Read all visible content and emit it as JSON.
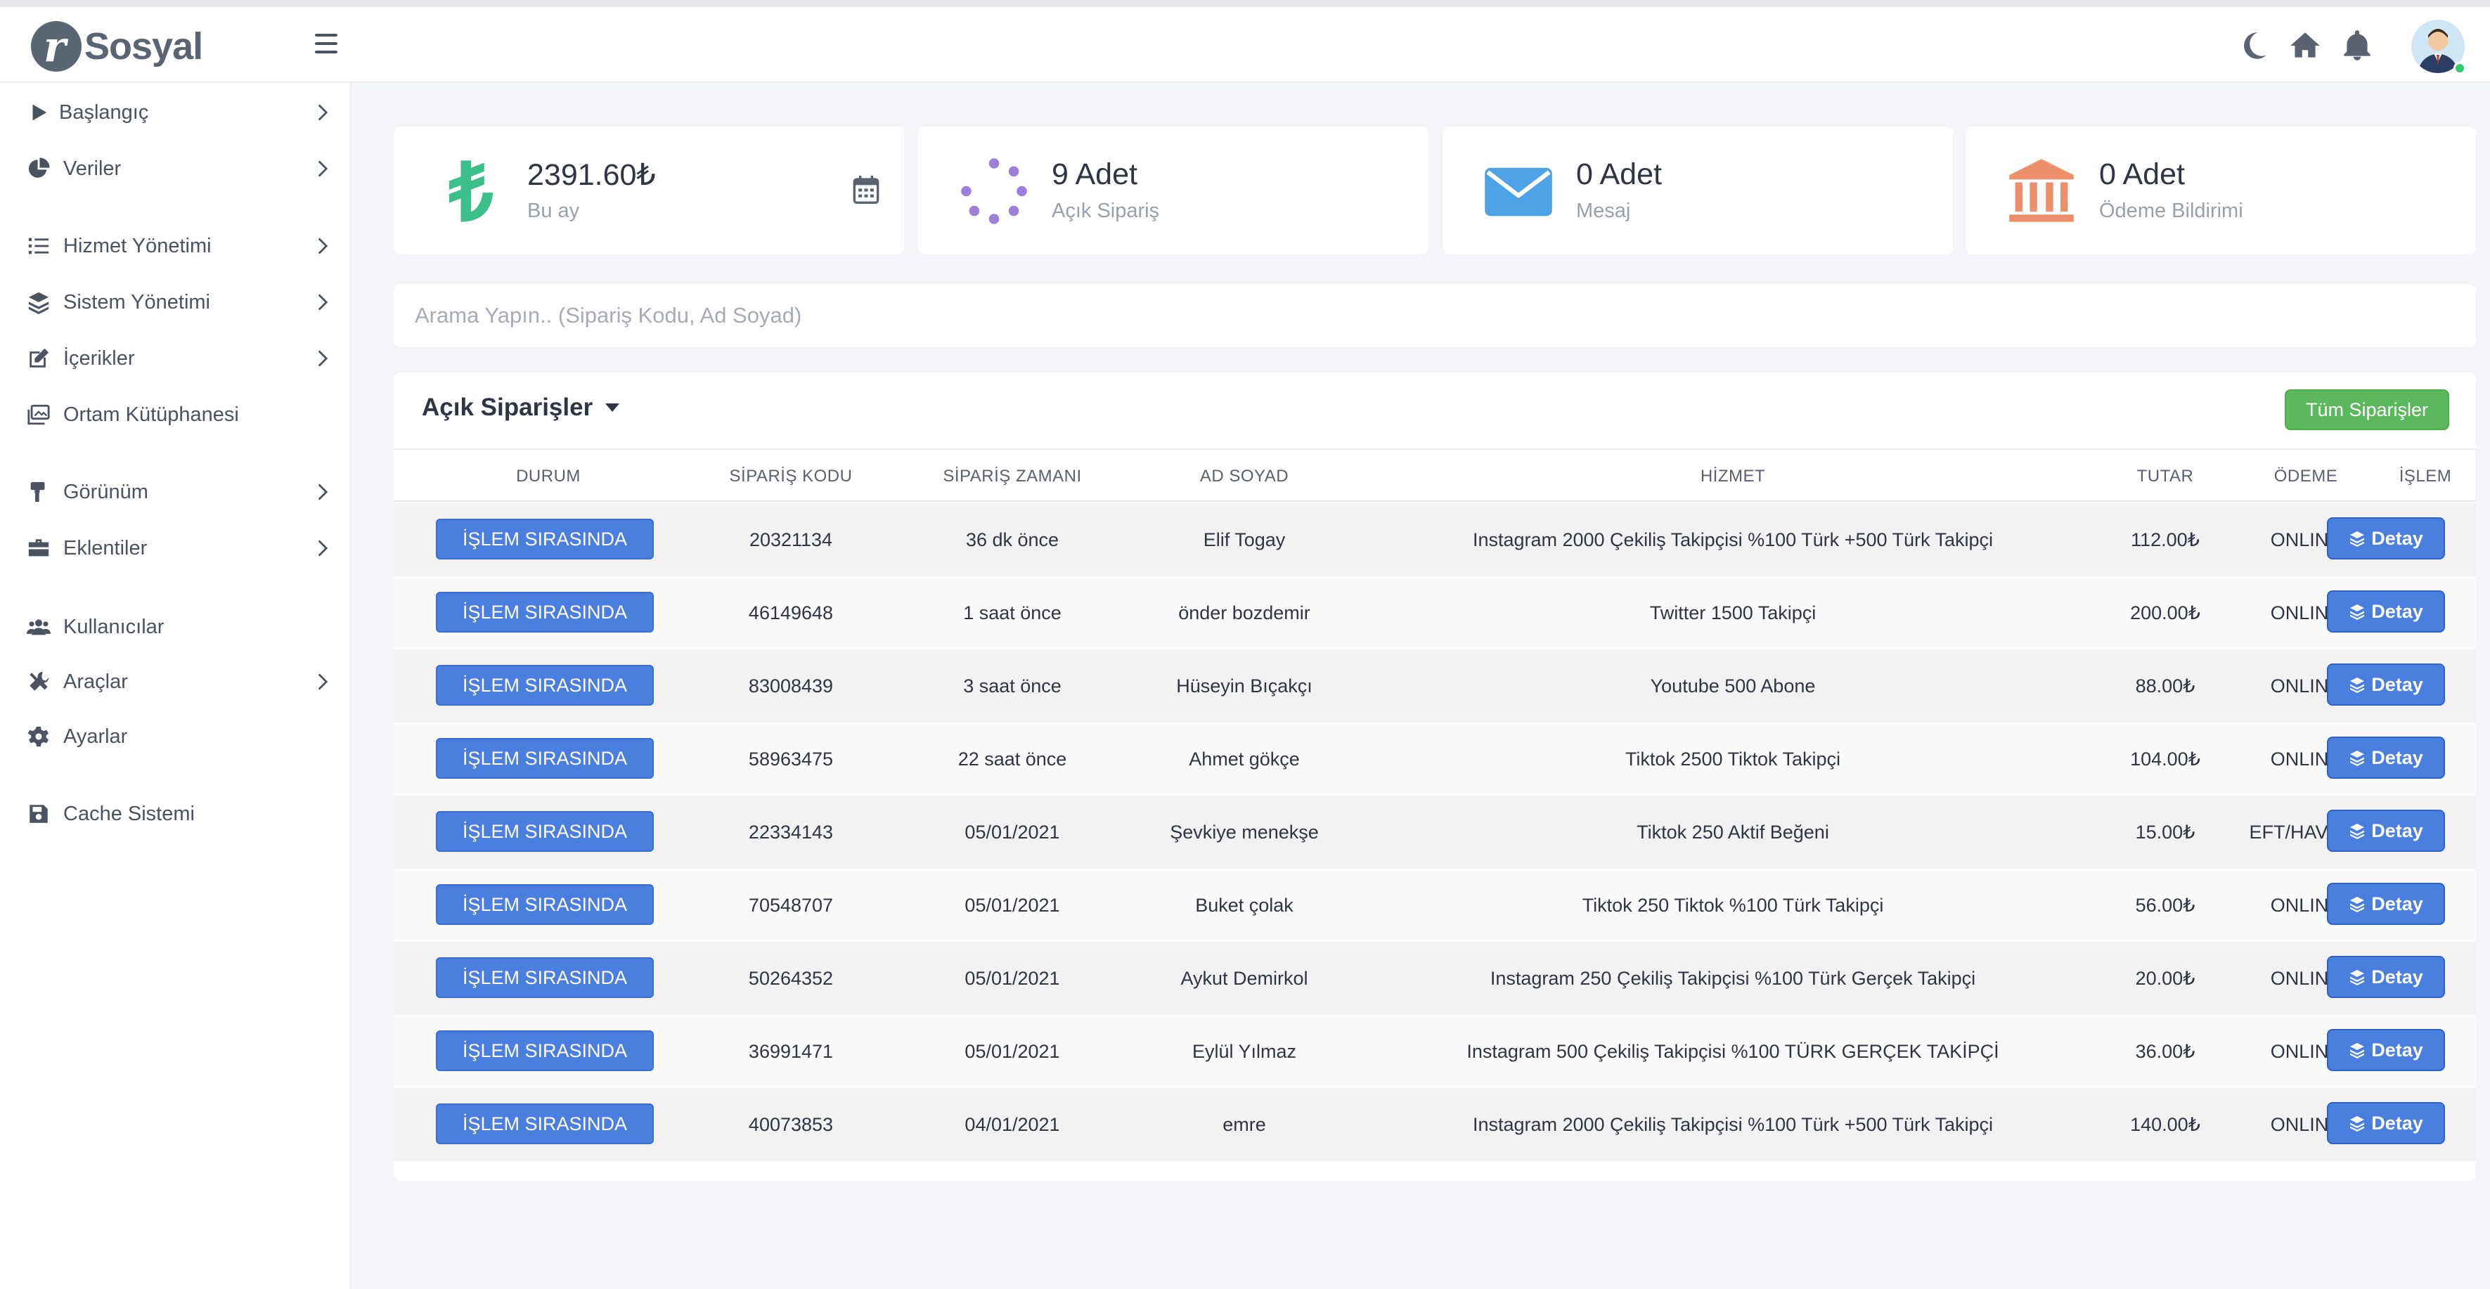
{
  "brand": {
    "name": "Sosyal"
  },
  "sidebar": {
    "items": [
      {
        "label": "Başlangıç",
        "icon": "play-icon",
        "has_children": true
      },
      {
        "label": "Veriler",
        "icon": "pie-chart-icon",
        "has_children": true
      },
      {
        "label": "Hizmet Yönetimi",
        "icon": "list-icon",
        "has_children": true
      },
      {
        "label": "Sistem Yönetimi",
        "icon": "layers-icon",
        "has_children": true
      },
      {
        "label": "İçerikler",
        "icon": "edit-icon",
        "has_children": true
      },
      {
        "label": "Ortam Kütüphanesi",
        "icon": "images-icon",
        "has_children": false
      },
      {
        "label": "Görünüm",
        "icon": "paint-roller-icon",
        "has_children": true
      },
      {
        "label": "Eklentiler",
        "icon": "briefcase-icon",
        "has_children": true
      },
      {
        "label": "Kullanıcılar",
        "icon": "users-icon",
        "has_children": false
      },
      {
        "label": "Araçlar",
        "icon": "tools-icon",
        "has_children": true
      },
      {
        "label": "Ayarlar",
        "icon": "gear-icon",
        "has_children": false
      },
      {
        "label": "Cache Sistemi",
        "icon": "floppy-disk-icon",
        "has_children": false
      }
    ]
  },
  "stats": [
    {
      "value": "2391.60₺",
      "label": "Bu ay",
      "icon": "lira-icon",
      "color": "#3bbf8b"
    },
    {
      "value": "9 Adet",
      "label": "Açık Sipariş",
      "icon": "spinner-icon",
      "color": "#9b7fd9"
    },
    {
      "value": "0 Adet",
      "label": "Mesaj",
      "icon": "envelope-icon",
      "color": "#4ea3e6"
    },
    {
      "value": "0 Adet",
      "label": "Ödeme Bildirimi",
      "icon": "bank-icon",
      "color": "#ee8f6c"
    }
  ],
  "search": {
    "placeholder": "Arama Yapın.. (Sipariş Kodu, Ad Soyad)"
  },
  "orders": {
    "title": "Açık Siparişler",
    "all_button": "Tüm Siparişler",
    "columns": [
      "DURUM",
      "SİPARİŞ KODU",
      "SİPARİŞ ZAMANI",
      "AD SOYAD",
      "HİZMET",
      "TUTAR",
      "ÖDEME",
      "İŞLEM"
    ],
    "action_label": "Detay",
    "rows": [
      {
        "status": "İŞLEM SIRASINDA",
        "code": "20321134",
        "time": "36 dk önce",
        "name": "Elif Togay",
        "service": "Instagram 2000 Çekiliş Takipçisi %100 Türk +500 Türk Takipçi",
        "amount": "112.00₺",
        "payment": "ONLINE"
      },
      {
        "status": "İŞLEM SIRASINDA",
        "code": "46149648",
        "time": "1 saat önce",
        "name": "önder bozdemir",
        "service": "Twitter 1500 Takipçi",
        "amount": "200.00₺",
        "payment": "ONLINE"
      },
      {
        "status": "İŞLEM SIRASINDA",
        "code": "83008439",
        "time": "3 saat önce",
        "name": "Hüseyin Bıçakçı",
        "service": "Youtube 500 Abone",
        "amount": "88.00₺",
        "payment": "ONLINE"
      },
      {
        "status": "İŞLEM SIRASINDA",
        "code": "58963475",
        "time": "22 saat önce",
        "name": "Ahmet gökçe",
        "service": "Tiktok 2500 Tiktok Takipçi",
        "amount": "104.00₺",
        "payment": "ONLINE"
      },
      {
        "status": "İŞLEM SIRASINDA",
        "code": "22334143",
        "time": "05/01/2021",
        "name": "Şevkiye menekşe",
        "service": "Tiktok 250 Aktif Beğeni",
        "amount": "15.00₺",
        "payment": "EFT/HAVALE"
      },
      {
        "status": "İŞLEM SIRASINDA",
        "code": "70548707",
        "time": "05/01/2021",
        "name": "Buket çolak",
        "service": "Tiktok 250 Tiktok %100 Türk Takipçi",
        "amount": "56.00₺",
        "payment": "ONLINE"
      },
      {
        "status": "İŞLEM SIRASINDA",
        "code": "50264352",
        "time": "05/01/2021",
        "name": "Aykut Demirkol",
        "service": "Instagram 250 Çekiliş Takipçisi %100 Türk Gerçek Takipçi",
        "amount": "20.00₺",
        "payment": "ONLINE"
      },
      {
        "status": "İŞLEM SIRASINDA",
        "code": "36991471",
        "time": "05/01/2021",
        "name": "Eylül Yılmaz",
        "service": "Instagram 500 Çekiliş Takipçisi %100 TÜRK GERÇEK TAKİPÇİ",
        "amount": "36.00₺",
        "payment": "ONLINE"
      },
      {
        "status": "İŞLEM SIRASINDA",
        "code": "40073853",
        "time": "04/01/2021",
        "name": "emre",
        "service": "Instagram 2000 Çekiliş Takipçisi %100 Türk +500 Türk Takipçi",
        "amount": "140.00₺",
        "payment": "ONLINE"
      }
    ]
  },
  "colors": {
    "primary": "#4a7fe0",
    "success": "#5cb85c",
    "sidebar_text": "#4b5260"
  }
}
